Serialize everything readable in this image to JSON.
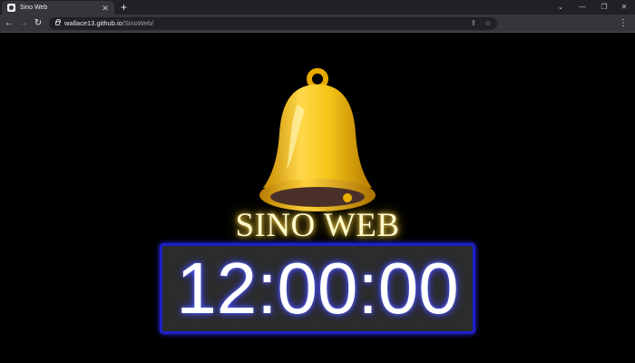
{
  "browser": {
    "tab_title": "Sino Web",
    "tab_close": "✕",
    "new_tab": "+",
    "url_host": "wallace13.github.io",
    "url_path": "/SinoWeb/",
    "window_controls": [
      "⌄",
      "—",
      "❐",
      "✕"
    ],
    "nav": {
      "back": "←",
      "forward": "→",
      "reload": "↻"
    },
    "share_icon": "⇪",
    "star_icon": "☆",
    "menu_icon": "⋮"
  },
  "page": {
    "title": "SINO WEB",
    "clock": "12:00:00",
    "colors": {
      "background": "#000000",
      "bell_gold": "#f5c518",
      "clock_border": "#1e20c8",
      "clock_bg": "#2b2c2b"
    },
    "icons": [
      "bell-icon"
    ]
  }
}
